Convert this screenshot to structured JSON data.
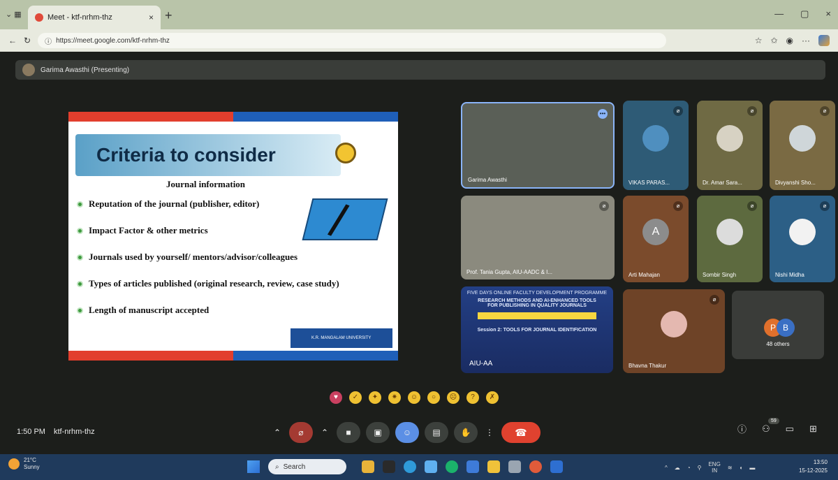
{
  "browser": {
    "tab_title": "Meet - ktf-nrhm-thz",
    "tab_close": "×",
    "new_tab": "+",
    "url": "https://meet.google.com/ktf-nrhm-thz",
    "window_controls": [
      "—",
      "▢",
      "×"
    ]
  },
  "meet": {
    "presenter_label": "Garima Awasthi (Presenting)",
    "slide": {
      "title": "Criteria to consider",
      "subtitle": "Journal information",
      "bullets": [
        "Reputation of the journal (publisher, editor)",
        "Impact Factor & other metrics",
        "Journals used by yourself/ mentors/advisor/colleagues",
        "Types of articles published (original research, review, case study)",
        "Length of manuscript accepted"
      ],
      "logo_text": "K.R. MANGALAM UNIVERSITY"
    },
    "participants": [
      {
        "name": "Garima Awasthi"
      },
      {
        "name": "VIKAS PARAS..."
      },
      {
        "name": "Dr. Amar Sara..."
      },
      {
        "name": "Divyanshi Sho..."
      },
      {
        "name": "Prof. Tania Gupta, AIU-AADC & I..."
      },
      {
        "name": "Arti Mahajan",
        "initial": "A"
      },
      {
        "name": "Sombir Singh"
      },
      {
        "name": "Nishi Midha"
      },
      {
        "name": "Bhavna Thakur"
      }
    ],
    "poster": {
      "heading": "FIVE DAYS ONLINE FACULTY DEVELOPMENT PROGRAMME",
      "line1": "RESEARCH METHODS AND AI-ENHANCED TOOLS FOR PUBLISHING IN QUALITY JOURNALS",
      "session": "Session 2: TOOLS FOR JOURNAL IDENTIFICATION",
      "footer": "AIU-AA"
    },
    "others": {
      "avatar1": "P",
      "avatar2": "B",
      "count_label": "48 others"
    },
    "time": "1:50 PM",
    "meeting_code": "ktf-nrhm-thz",
    "participant_badge": "59"
  },
  "taskbar": {
    "temperature": "21°C",
    "weather": "Sunny",
    "search_placeholder": "Search",
    "lang": "ENG",
    "region": "IN",
    "clock_time": "13:50",
    "clock_date": "15-12-2025"
  }
}
